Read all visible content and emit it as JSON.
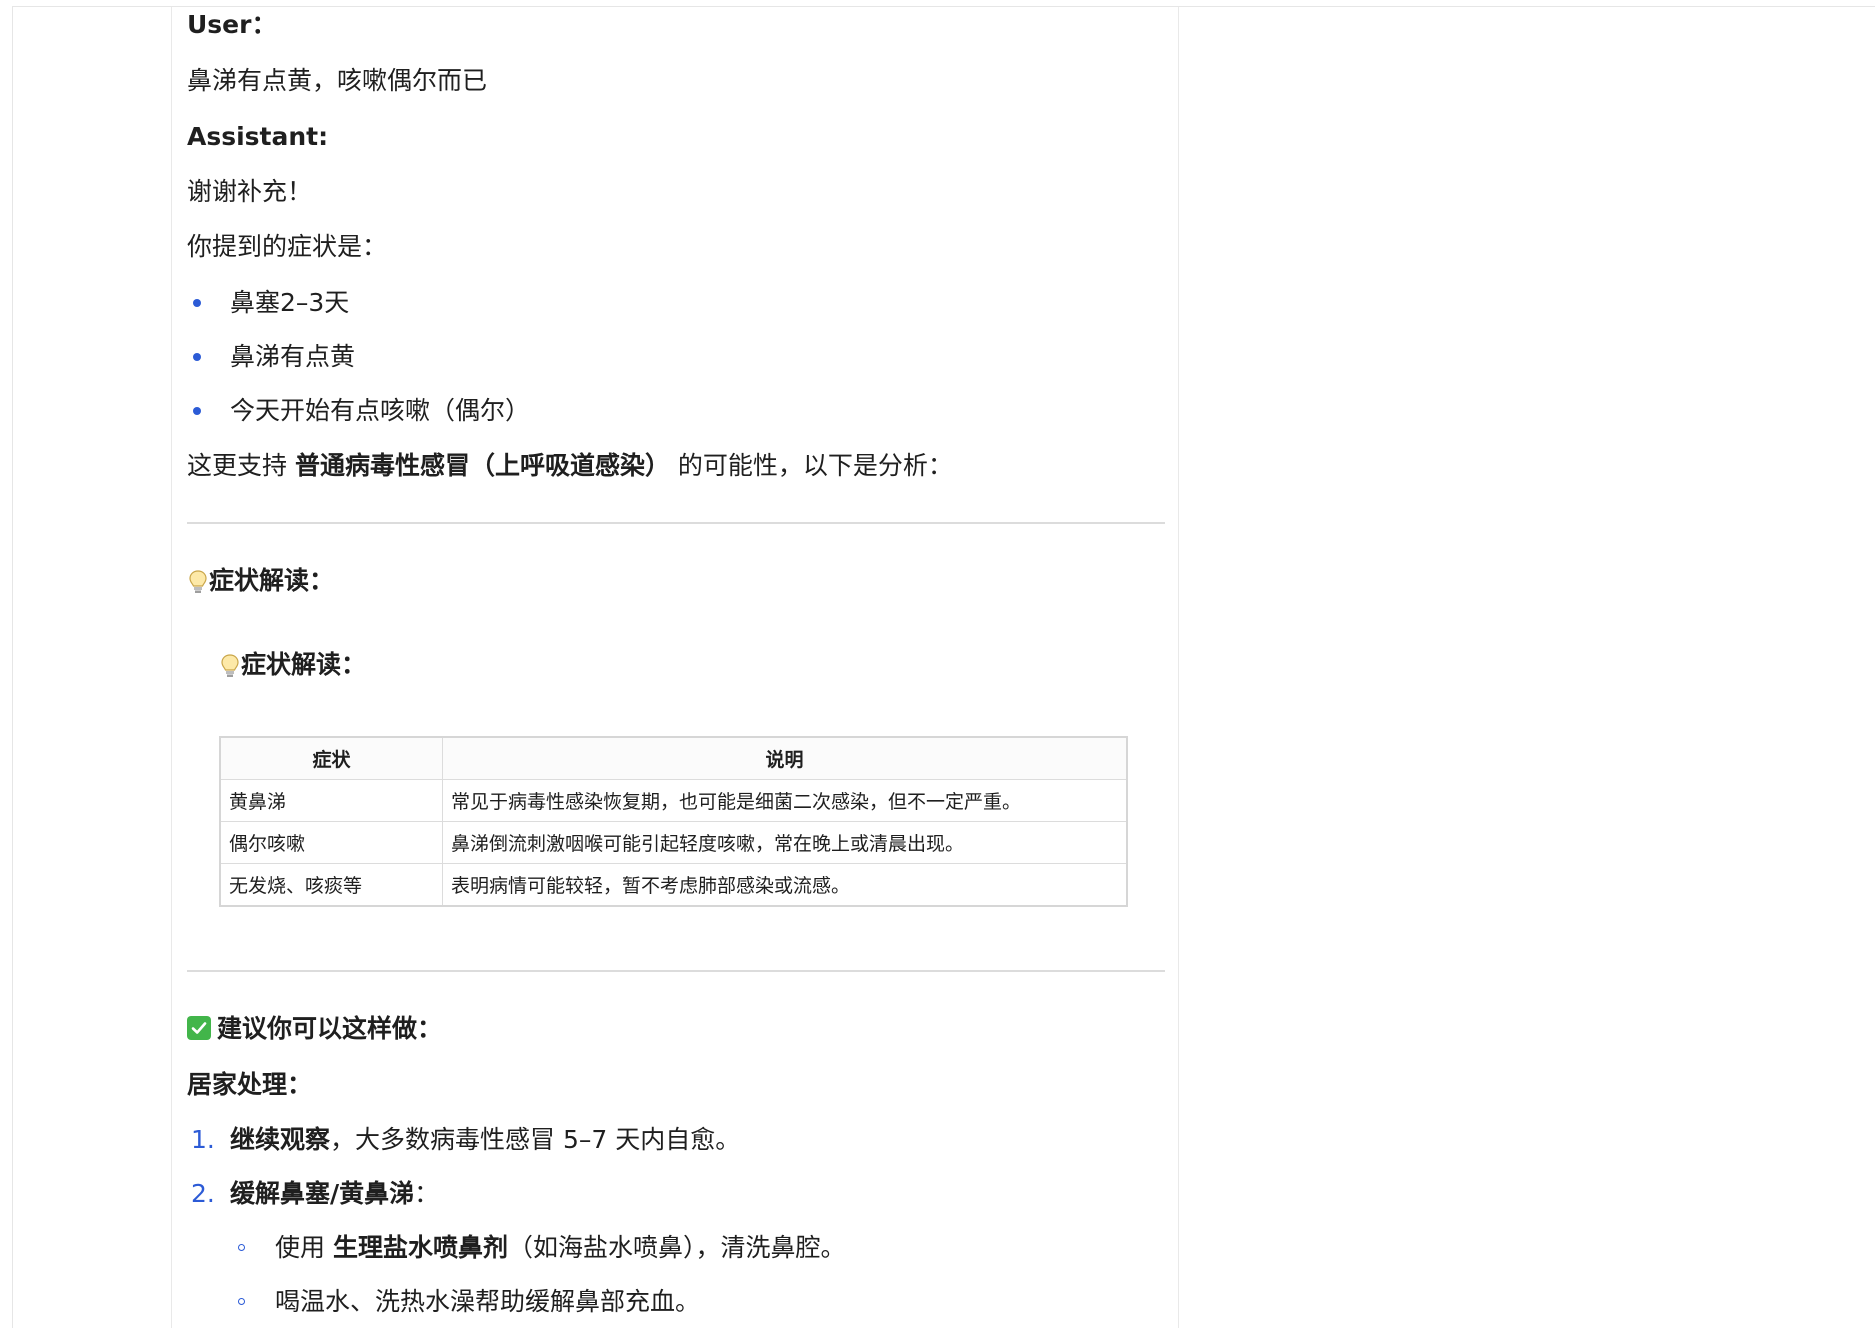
{
  "conversation": {
    "user_label": "User：",
    "user_message": "鼻涕有点黄，咳嗽偶尔而已",
    "assistant_label": "Assistant:",
    "thanks": "谢谢补充！",
    "symptoms_intro": "你提到的症状是：",
    "symptoms": [
      "鼻塞2–3天",
      "鼻涕有点黄",
      "今天开始有点咳嗽（偶尔）"
    ],
    "support_prefix": "这更支持 ",
    "support_bold": "普通病毒性感冒（上呼吸道感染）",
    "support_suffix": " 的可能性，以下是分析："
  },
  "section_interpret": {
    "heading": "症状解读：",
    "sub_heading": "症状解读："
  },
  "table": {
    "headers": [
      "症状",
      "说明"
    ],
    "rows": [
      [
        "黄鼻涕",
        "常见于病毒性感染恢复期，也可能是细菌二次感染，但不一定严重。"
      ],
      [
        "偶尔咳嗽",
        "鼻涕倒流刺激咽喉可能引起轻度咳嗽，常在晚上或清晨出现。"
      ],
      [
        "无发烧、咳痰等",
        "表明病情可能较轻，暂不考虑肺部感染或流感。"
      ]
    ]
  },
  "section_advice": {
    "heading": "建议你可以这样做：",
    "home_care": "居家处理：",
    "items": [
      {
        "num": "1.",
        "bold": "继续观察",
        "text": "，大多数病毒性感冒 5–7 天内自愈。"
      },
      {
        "num": "2.",
        "bold": "缓解鼻塞/黄鼻涕",
        "text": "："
      }
    ],
    "sub_items": [
      {
        "prefix": "使用 ",
        "bold": "生理盐水喷鼻剂",
        "text": "（如海盐水喷鼻），清洗鼻腔。"
      },
      {
        "prefix": "",
        "bold": "",
        "text": "喝温水、洗热水澡帮助缓解鼻部充血。"
      }
    ]
  },
  "colors": {
    "accent_blue": "#2c5bd6",
    "check_green": "#42b54a",
    "bulb_yellow": "#f4c542"
  }
}
